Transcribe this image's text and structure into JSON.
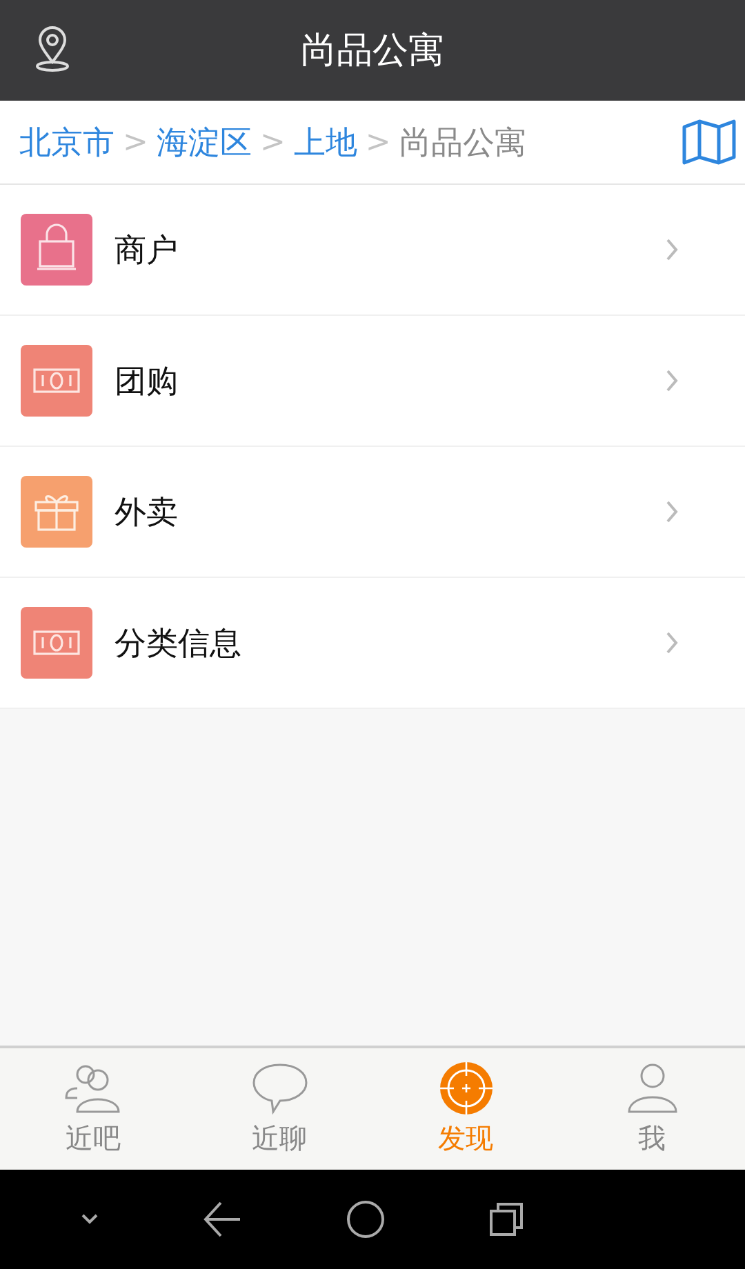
{
  "header": {
    "title": "尚品公寓"
  },
  "breadcrumb": {
    "separator": ">",
    "items": [
      {
        "label": "北京市",
        "current": false
      },
      {
        "label": "海淀区",
        "current": false
      },
      {
        "label": "上地",
        "current": false
      },
      {
        "label": "尚品公寓",
        "current": true
      }
    ]
  },
  "menu": [
    {
      "label": "商户",
      "kind": "bag",
      "color": "#e8718b"
    },
    {
      "label": "团购",
      "kind": "money",
      "color": "#ef8476"
    },
    {
      "label": "外卖",
      "kind": "gift",
      "color": "#f6a06e"
    },
    {
      "label": "分类信息",
      "kind": "money",
      "color": "#ef8476"
    }
  ],
  "tabs": [
    {
      "label": "近吧",
      "kind": "people",
      "selected": false
    },
    {
      "label": "近聊",
      "kind": "chat",
      "selected": false
    },
    {
      "label": "发现",
      "kind": "target",
      "selected": true
    },
    {
      "label": "我",
      "kind": "person",
      "selected": false
    }
  ]
}
